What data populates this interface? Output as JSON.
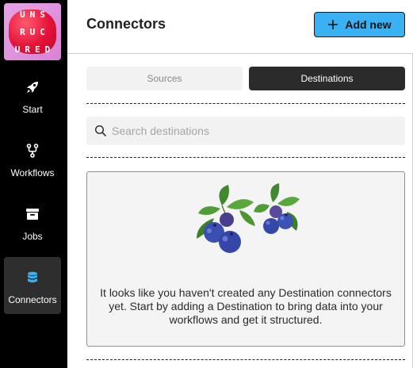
{
  "logo": {
    "line1": "UNS",
    "line2": "RUC",
    "line3": "URED"
  },
  "sidebar": {
    "items": [
      {
        "label": "Start",
        "icon": "rocket-icon"
      },
      {
        "label": "Workflows",
        "icon": "workflow-icon"
      },
      {
        "label": "Jobs",
        "icon": "archive-box-icon"
      },
      {
        "label": "Connectors",
        "icon": "database-icon",
        "active": true
      }
    ]
  },
  "header": {
    "title": "Connectors",
    "add_button_label": "Add new"
  },
  "tabs": [
    {
      "label": "Sources",
      "selected": false
    },
    {
      "label": "Destinations",
      "selected": true
    }
  ],
  "search": {
    "placeholder": "Search destinations",
    "value": ""
  },
  "empty_state": {
    "message": "It looks like you haven't created any Destination connectors yet. Start by adding a Destination to bring data into your workflows and get it structured.",
    "illustration": "blueberries-illustration"
  },
  "colors": {
    "accent": "#3ab1f2",
    "sidebar_bg": "#000000",
    "active_tab_bg": "#2b2b2b"
  }
}
